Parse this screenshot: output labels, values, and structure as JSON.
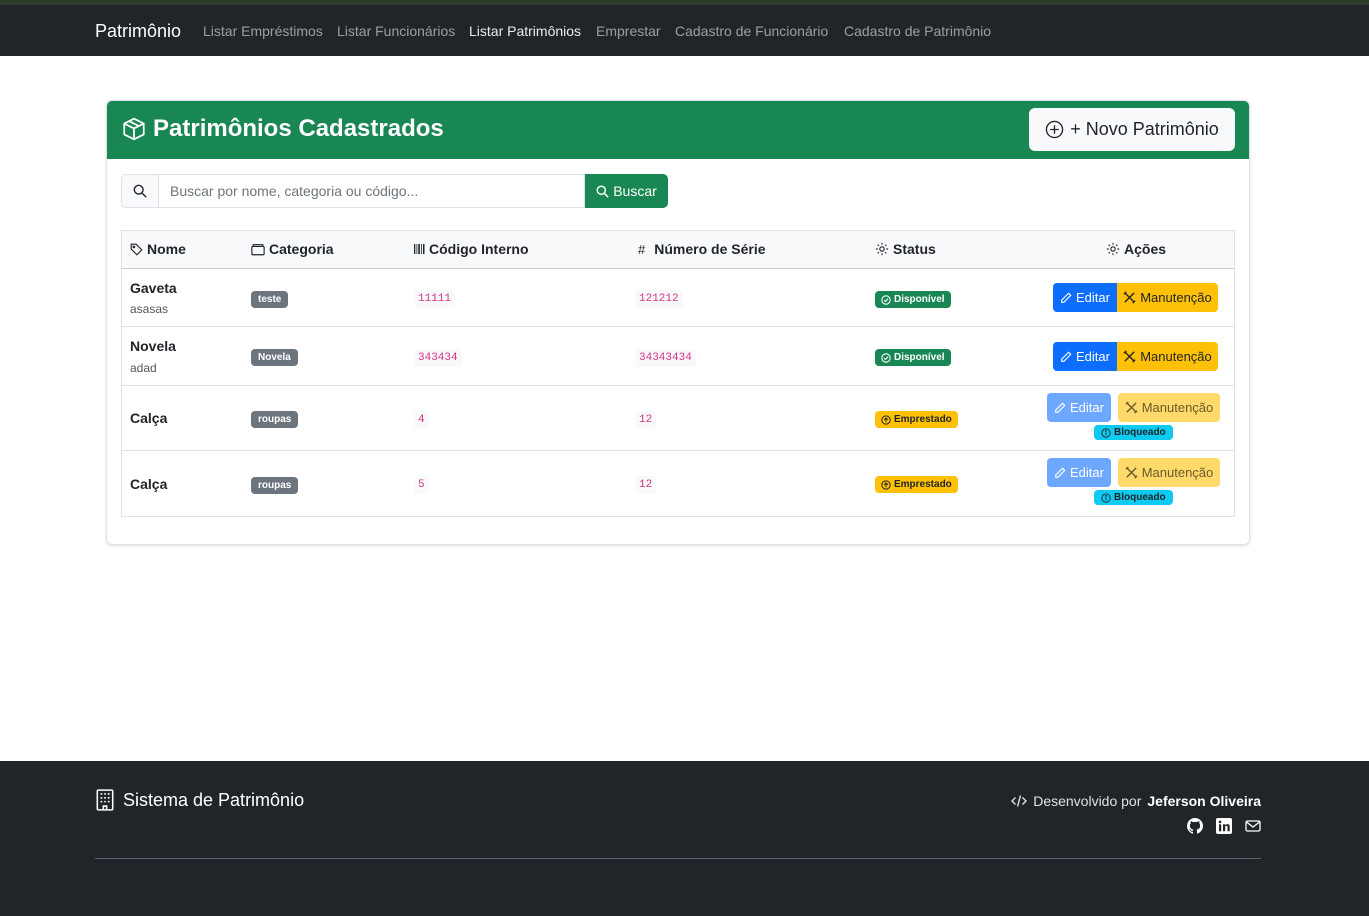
{
  "navbar": {
    "brand": "Patrimônio",
    "links": [
      {
        "label": "Listar Empréstimos",
        "active": false
      },
      {
        "label": "Listar Funcionários",
        "active": false
      },
      {
        "label": "Listar Patrimônios",
        "active": true
      },
      {
        "label": "Emprestar",
        "active": false
      },
      {
        "label": "Cadastro de Funcionário",
        "active": false
      },
      {
        "label": "Cadastro de Patrimônio",
        "active": false
      }
    ]
  },
  "card": {
    "title": "Patrimônios Cadastrados",
    "title_icon": "box-icon",
    "new_button": "+ Novo Patrimônio"
  },
  "search": {
    "placeholder": "Buscar por nome, categoria ou código...",
    "value": "",
    "button": "Buscar"
  },
  "table": {
    "headers": {
      "name": "Nome",
      "category": "Categoria",
      "code": "Código Interno",
      "serial": "Número de Série",
      "status": "Status",
      "actions": "Ações"
    },
    "rows": [
      {
        "name": "Gaveta",
        "description": "asasas",
        "category": "teste",
        "code": "11111",
        "serial": "121212",
        "status": "Disponível",
        "edit": "Editar",
        "maintenance": "Manutenção",
        "blocked": ""
      },
      {
        "name": "Novela",
        "description": "adad",
        "category": "Novela",
        "code": "343434",
        "serial": "34343434",
        "status": "Disponível",
        "edit": "Editar",
        "maintenance": "Manutenção",
        "blocked": ""
      },
      {
        "name": "Calça",
        "description": "",
        "category": "roupas",
        "code": "4",
        "serial": "12",
        "status": "Emprestado",
        "edit": "Editar",
        "maintenance": "Manutenção",
        "blocked": "Bloqueado"
      },
      {
        "name": "Calça",
        "description": "",
        "category": "roupas",
        "code": "5",
        "serial": "12",
        "status": "Emprestado",
        "edit": "Editar",
        "maintenance": "Manutenção",
        "blocked": "Bloqueado"
      }
    ]
  },
  "footer": {
    "brand": "Sistema de Patrimônio",
    "dev_prefix": "Desenvolvido por",
    "dev_name": "Jeferson Oliveira",
    "social": [
      "github-icon",
      "linkedin-icon",
      "envelope-icon"
    ]
  },
  "colors": {
    "navbar_bg": "#212529",
    "header_green": "#198754",
    "primary": "#0d6efd",
    "warning": "#ffc107",
    "info": "#0dcaf0",
    "code_pink": "#d63384"
  }
}
